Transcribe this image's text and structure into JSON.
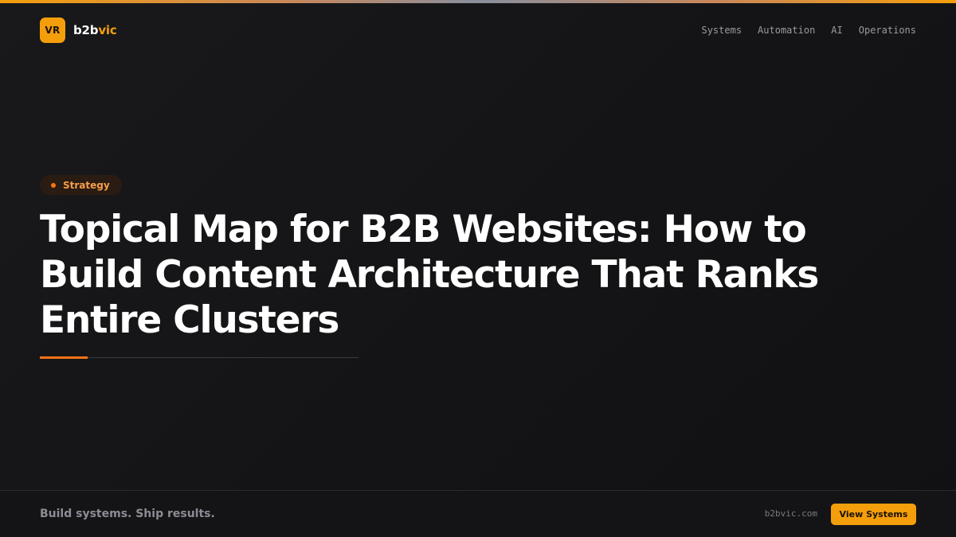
{
  "brand": {
    "logo_initials": "VR",
    "name_main": "b2b",
    "name_accent": "vic"
  },
  "nav": {
    "items": [
      {
        "label": "Systems"
      },
      {
        "label": "Automation"
      },
      {
        "label": "AI"
      },
      {
        "label": "Operations"
      }
    ]
  },
  "hero": {
    "tag": "Strategy",
    "title": "Topical Map for B2B Websites: How to Build Content Architecture That Ranks Entire Clusters"
  },
  "footer": {
    "tagline": "Build systems. Ship results.",
    "domain": "b2bvic.com",
    "cta_label": "View Systems"
  },
  "colors": {
    "accent": "#f59e0b",
    "tag_accent": "#f97316",
    "background": "#141416"
  }
}
